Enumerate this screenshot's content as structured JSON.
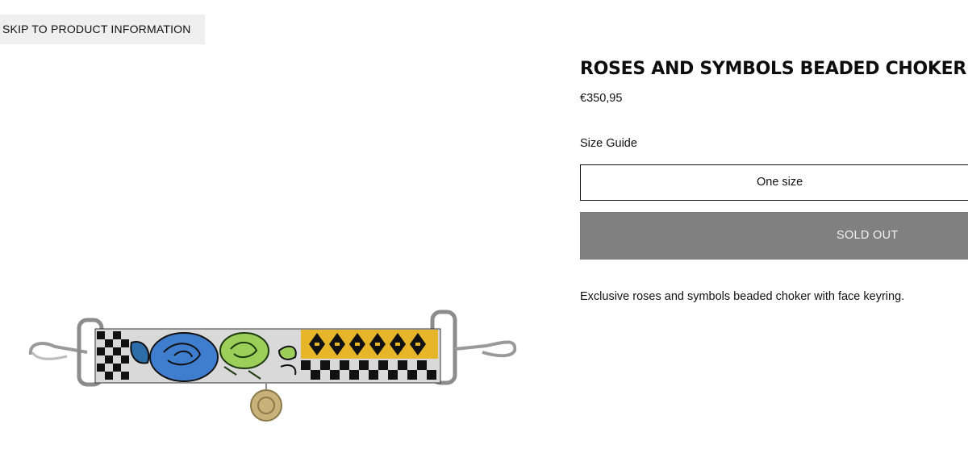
{
  "skip_link": {
    "label": "SKIP TO PRODUCT INFORMATION"
  },
  "product": {
    "title": "ROSES AND SYMBOLS BEADED CHOKER",
    "price": "€350,95",
    "size_guide_label": "Size Guide",
    "size_option": "One size",
    "cta_label": "SOLD OUT",
    "description": "Exclusive roses and symbols beaded choker with face keyring."
  },
  "colors": {
    "sold_out_bg": "#808080",
    "skip_bg": "#efefef",
    "bead_blue": "#3f7ecf",
    "bead_green": "#9ccf5a",
    "bead_yellow": "#e6b52a"
  },
  "icons": [
    "beaded-choker-image"
  ]
}
